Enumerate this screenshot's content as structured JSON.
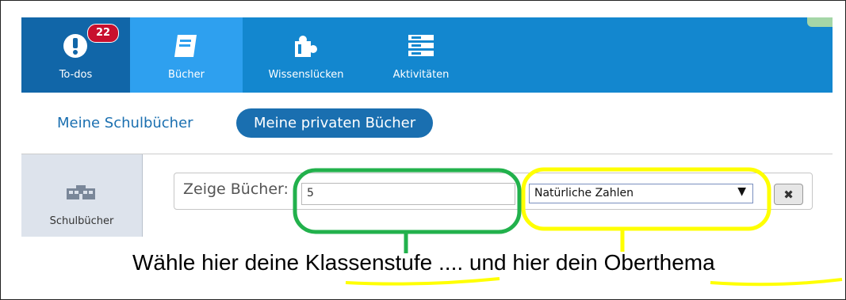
{
  "nav": {
    "items": [
      {
        "label": "To-dos",
        "icon": "alert-circle-icon"
      },
      {
        "label": "Bücher",
        "icon": "book-icon"
      },
      {
        "label": "Wissenslücken",
        "icon": "puzzle-icon"
      },
      {
        "label": "Aktivitäten",
        "icon": "list-icon"
      }
    ],
    "badge": "22"
  },
  "subtabs": {
    "schoolbooks": "Meine Schulbücher",
    "private": "Meine privaten Bücher"
  },
  "side": {
    "label": "Schulbücher",
    "icon": "school-building-icon"
  },
  "filter": {
    "label": "Zeige Bücher:",
    "grade_value": "5",
    "topic_value": "Natürliche Zahlen",
    "clear_symbol": "✖"
  },
  "annotation": {
    "part1": "Wähle hier deine ",
    "word1": "Klassenstufe",
    "part2": " .... und hier dein ",
    "word2": "Oberthema",
    "colors": {
      "green": "#22b14c",
      "yellow": "#ffff00"
    }
  },
  "colors": {
    "nav_bg": "#1387cf",
    "nav_active": "#2ea0ef",
    "accent": "#1a6fb0",
    "badge": "#c8102e"
  }
}
